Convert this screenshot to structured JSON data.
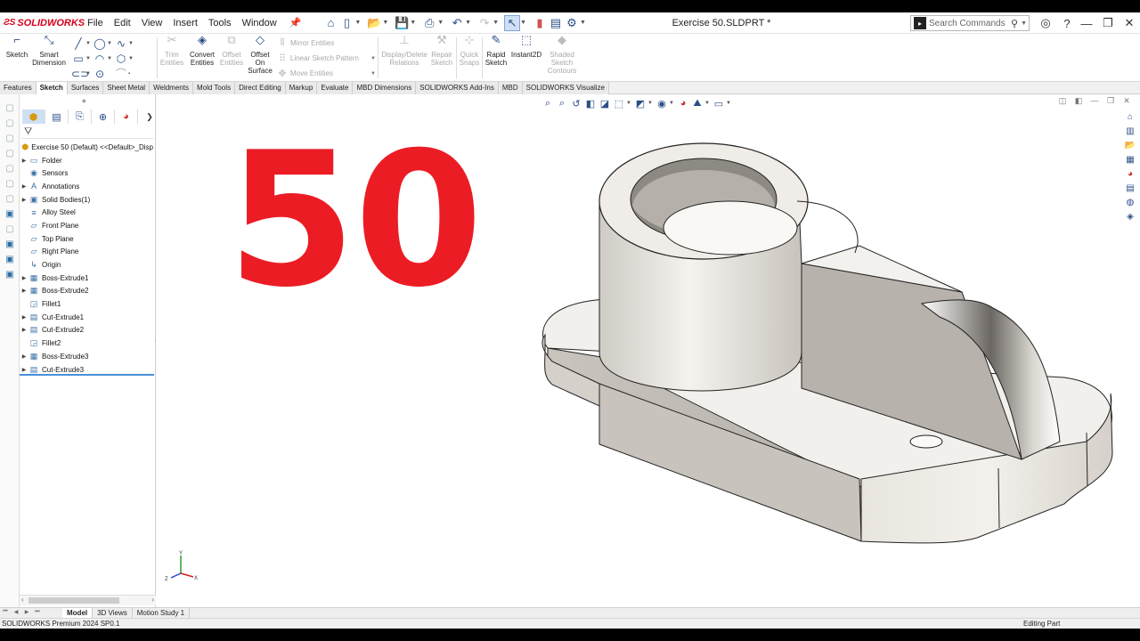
{
  "app": {
    "brand": "SOLIDWORKS",
    "document_title": "Exercise 50.SLDPRT *",
    "menu": [
      "File",
      "Edit",
      "View",
      "Insert",
      "Tools",
      "Window"
    ]
  },
  "search": {
    "placeholder": "Search Commands"
  },
  "command_manager": {
    "sketch": "Sketch",
    "smart_dimension": [
      "Smart",
      "Dimension"
    ],
    "trim_entities": [
      "Trim",
      "Entities"
    ],
    "convert_entities": [
      "Convert",
      "Entities"
    ],
    "offset_entities": [
      "Offset",
      "Entities"
    ],
    "offset_on_surface": [
      "Offset",
      "On",
      "Surface"
    ],
    "mirror_entities": "Mirror Entities",
    "linear_sketch_pattern": "Linear Sketch Pattern",
    "move_entities": "Move Entities",
    "display_delete_relations": [
      "Display/Delete",
      "Relations"
    ],
    "repair_sketch": [
      "Repair",
      "Sketch"
    ],
    "quick_snaps": [
      "Quick",
      "Snaps"
    ],
    "rapid_sketch": [
      "Rapid",
      "Sketch"
    ],
    "instant2d": "Instant2D",
    "shaded_sketch_contours": [
      "Shaded",
      "Sketch",
      "Contours"
    ]
  },
  "tabs": [
    "Features",
    "Sketch",
    "Surfaces",
    "Sheet Metal",
    "Weldments",
    "Mold Tools",
    "Direct Editing",
    "Markup",
    "Evaluate",
    "MBD Dimensions",
    "SOLIDWORKS Add-Ins",
    "MBD",
    "SOLIDWORKS Visualize"
  ],
  "active_tab": "Sketch",
  "feature_tree": {
    "root": "Exercise 50 (Default) <<Default>_Disp",
    "items": [
      {
        "label": "Folder",
        "icon": "folder-icon",
        "expandable": true
      },
      {
        "label": "Sensors",
        "icon": "sensor-icon",
        "expandable": false
      },
      {
        "label": "Annotations",
        "icon": "annotation-icon",
        "expandable": true
      },
      {
        "label": "Solid Bodies(1)",
        "icon": "solid-body-icon",
        "expandable": true
      },
      {
        "label": "Alloy Steel",
        "icon": "material-icon",
        "expandable": false
      },
      {
        "label": "Front Plane",
        "icon": "plane-icon",
        "expandable": false
      },
      {
        "label": "Top Plane",
        "icon": "plane-icon",
        "expandable": false
      },
      {
        "label": "Right Plane",
        "icon": "plane-icon",
        "expandable": false
      },
      {
        "label": "Origin",
        "icon": "origin-icon",
        "expandable": false
      },
      {
        "label": "Boss-Extrude1",
        "icon": "extrude-icon",
        "expandable": true
      },
      {
        "label": "Boss-Extrude2",
        "icon": "extrude-icon",
        "expandable": true
      },
      {
        "label": "Fillet1",
        "icon": "fillet-icon",
        "expandable": false
      },
      {
        "label": "Cut-Extrude1",
        "icon": "cut-icon",
        "expandable": true
      },
      {
        "label": "Cut-Extrude2",
        "icon": "cut-icon",
        "expandable": true
      },
      {
        "label": "Fillet2",
        "icon": "fillet-icon",
        "expandable": false
      },
      {
        "label": "Boss-Extrude3",
        "icon": "extrude-icon",
        "expandable": true
      },
      {
        "label": "Cut-Extrude3",
        "icon": "cut-icon",
        "expandable": true
      }
    ]
  },
  "graphics": {
    "overlay_number": "50",
    "overlay_color": "#ec1c24",
    "triad": {
      "x": "X",
      "y": "Y",
      "z": "Z"
    }
  },
  "bottom_tabs": [
    "Model",
    "3D Views",
    "Motion Study 1"
  ],
  "active_bottom_tab": "Model",
  "status": {
    "left": "SOLIDWORKS Premium 2024 SP0.1",
    "right": "Editing Part"
  }
}
